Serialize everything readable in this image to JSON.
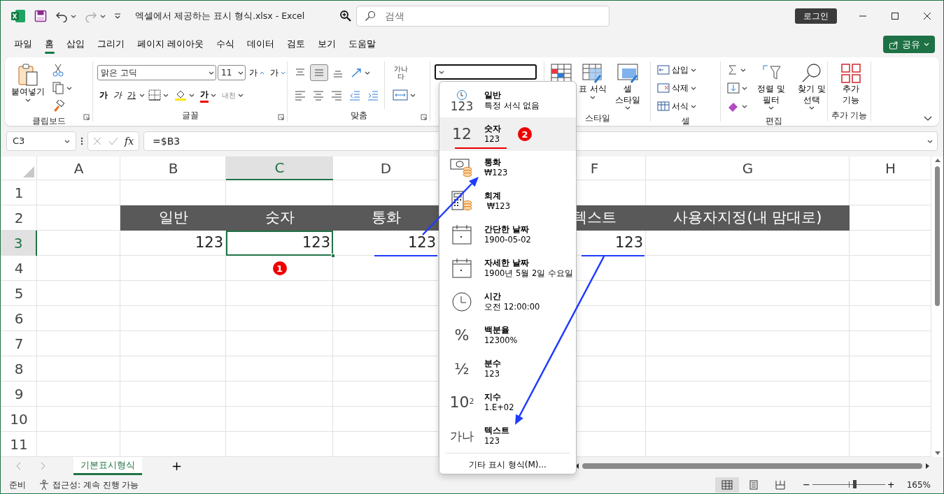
{
  "window": {
    "title": "엑셀에서 제공하는 표시 형식.xlsx - Excel",
    "search": {
      "placeholder": "검색"
    },
    "login": "로그인"
  },
  "menu": {
    "tabs": [
      {
        "label": "파일",
        "selected": false
      },
      {
        "label": "홈",
        "selected": true
      },
      {
        "label": "삽입",
        "selected": false
      },
      {
        "label": "그리기",
        "selected": false
      },
      {
        "label": "페이지 레이아웃",
        "selected": false
      },
      {
        "label": "수식",
        "selected": false
      },
      {
        "label": "데이터",
        "selected": false
      },
      {
        "label": "검토",
        "selected": false
      },
      {
        "label": "보기",
        "selected": false
      },
      {
        "label": "도움말",
        "selected": false
      }
    ],
    "share": "공유"
  },
  "ribbon": {
    "groups": [
      {
        "kind": "clipboard",
        "label": "클립보드",
        "launcher": true,
        "paste": "붙여넣기"
      },
      {
        "kind": "font",
        "label": "글꼴",
        "launcher": true,
        "font_name": "맑은 고딕",
        "font_size": "11",
        "grow": "가",
        "shrink": "가",
        "styles": [
          {
            "kind": "bold",
            "text": "가"
          },
          {
            "kind": "italic",
            "text": "가"
          },
          {
            "kind": "underline",
            "text": "가"
          }
        ],
        "font_color": "가",
        "phonetic": "내천"
      },
      {
        "kind": "alignment",
        "label": "맞춤",
        "launcher": true,
        "vertical": [
          {
            "kind": "top",
            "selected": false
          },
          {
            "kind": "middle",
            "selected": true
          },
          {
            "kind": "bottom",
            "selected": false
          }
        ],
        "wrap": "가나다"
      },
      {
        "kind": "number"
      },
      {
        "kind": "styles",
        "label": "스타일",
        "buttons": [
          "표 서식",
          "셀 스타일"
        ]
      },
      {
        "kind": "cells",
        "label": "셀",
        "buttons": [
          "삽입",
          "삭제",
          "서식"
        ]
      },
      {
        "kind": "editing",
        "label": "편집",
        "buttons": [
          "정렬 및 필터",
          "찾기 및 선택"
        ]
      },
      {
        "kind": "addins",
        "label": "추가 기능",
        "button": "추가 기능"
      }
    ]
  },
  "formula_bar": {
    "name_box": "C3",
    "function_label": "fx",
    "formula": "=$B3"
  },
  "sheet": {
    "columns": [
      {
        "label": "A",
        "selected": false
      },
      {
        "label": "B",
        "selected": false
      },
      {
        "label": "C",
        "selected": true
      },
      {
        "label": "D",
        "selected": false
      },
      null,
      {
        "label": "F",
        "selected": false
      },
      {
        "label": "G",
        "selected": false
      },
      {
        "label": "H",
        "selected": false
      }
    ],
    "rows": [
      {
        "label": "1",
        "selected": false,
        "cells": [
          null,
          null,
          null,
          null,
          null,
          null,
          null,
          null
        ]
      },
      {
        "label": "2",
        "selected": false,
        "cells": [
          null,
          {
            "kind": "header",
            "text": "일반",
            "selected": false
          },
          {
            "kind": "header",
            "text": "숫자",
            "selected": false
          },
          {
            "kind": "header",
            "text": "통화",
            "selected": false
          },
          null,
          {
            "kind": "header",
            "text": "텍스트",
            "selected": false
          },
          {
            "kind": "header",
            "text": "사용자지정(내 맘대로)",
            "selected": false
          },
          null
        ]
      },
      {
        "label": "3",
        "selected": true,
        "cells": [
          null,
          {
            "kind": "value",
            "text": "123",
            "selected": false
          },
          {
            "kind": "value",
            "text": "123",
            "selected": true
          },
          {
            "kind": "value",
            "text": "123",
            "selected": false,
            "underlined": true
          },
          null,
          {
            "kind": "value",
            "text": "123",
            "selected": false,
            "underlined": true
          },
          null,
          null
        ]
      },
      {
        "label": "4",
        "selected": false,
        "cells": [
          null,
          null,
          {
            "kind": "badge",
            "text": "1"
          },
          null,
          null,
          null,
          null,
          null
        ]
      },
      {
        "label": "5",
        "selected": false,
        "cells": [
          null,
          null,
          null,
          null,
          null,
          null,
          null,
          null
        ]
      },
      {
        "label": "6",
        "selected": false,
        "cells": [
          null,
          null,
          null,
          null,
          null,
          null,
          null,
          null
        ]
      },
      {
        "label": "7",
        "selected": false,
        "cells": [
          null,
          null,
          null,
          null,
          null,
          null,
          null,
          null
        ]
      },
      {
        "label": "8",
        "selected": false,
        "cells": [
          null,
          null,
          null,
          null,
          null,
          null,
          null,
          null
        ]
      },
      {
        "label": "9",
        "selected": false,
        "cells": [
          null,
          null,
          null,
          null,
          null,
          null,
          null,
          null
        ]
      },
      {
        "label": "10",
        "selected": false,
        "cells": [
          null,
          null,
          null,
          null,
          null,
          null,
          null,
          null
        ]
      },
      {
        "label": "11",
        "selected": false,
        "cells": [
          null,
          null,
          null,
          null,
          null,
          null,
          null,
          null
        ]
      }
    ]
  },
  "sheet_tabs": {
    "tabs": [
      {
        "label": "기본표시형식",
        "selected": true
      }
    ],
    "add": "+"
  },
  "status_bar": {
    "ready": "준비",
    "accessibility": "접근성: 계속 진행 가능",
    "views": [
      {
        "kind": "normal",
        "selected": true
      },
      {
        "kind": "page_layout",
        "selected": false
      },
      {
        "kind": "page_break",
        "selected": false
      }
    ],
    "zoom": {
      "out": "−",
      "in": "+",
      "level": 0.58,
      "reading": "165%"
    }
  },
  "format_menu": {
    "items": [
      {
        "kind": "general",
        "icon_text": "123",
        "title": "일반",
        "sample": "특정 서식 없음",
        "selected": false
      },
      {
        "kind": "number",
        "icon_text": "12",
        "title": "숫자",
        "sample": "123",
        "selected": true,
        "marked": true,
        "badge": "2"
      },
      {
        "kind": "currency",
        "title": "통화",
        "sample": "₩123",
        "selected": false
      },
      {
        "kind": "accounting",
        "title": "회계",
        "sample": " ₩123",
        "selected": false
      },
      {
        "kind": "date",
        "title": "간단한 날짜",
        "sample": "1900-05-02",
        "selected": false
      },
      {
        "kind": "date",
        "title": "자세한 날짜",
        "sample": "1900년 5월 2일 수요일",
        "selected": false
      },
      {
        "kind": "time",
        "title": "시간",
        "sample": "오전 12:00:00",
        "selected": false
      },
      {
        "kind": "percent",
        "icon_text": "%",
        "title": "백분율",
        "sample": "12300%",
        "selected": false
      },
      {
        "kind": "fraction",
        "icon_text": "½",
        "title": "분수",
        "sample": "123",
        "selected": false
      },
      {
        "kind": "scientific",
        "icon_text": "10$^{2}$",
        "title": "지수",
        "sample": "1.E+02",
        "selected": false
      },
      {
        "kind": "text",
        "icon_text": "가나",
        "title": "텍스트",
        "sample": "123",
        "selected": false
      }
    ],
    "footer": "기타 표시 형식(M)..."
  }
}
